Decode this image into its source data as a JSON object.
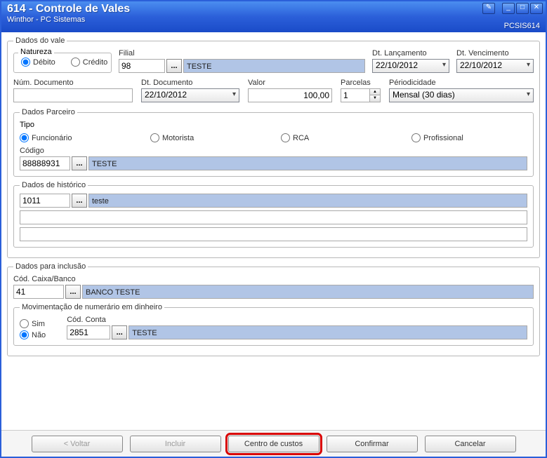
{
  "window": {
    "title": "614 - Controle de Vales",
    "subtitle": "Winthor - PC Sistemas",
    "code": "PCSIS614"
  },
  "dadosVale": {
    "legend": "Dados do vale",
    "natureza": {
      "legend": "Natureza",
      "debito": "Débito",
      "credito": "Crédito"
    },
    "filial": {
      "label": "Filial",
      "value": "98",
      "display": "TESTE"
    },
    "dtLanc": {
      "label": "Dt. Lançamento",
      "value": "22/10/2012"
    },
    "dtVenc": {
      "label": "Dt. Vencimento",
      "value": "22/10/2012"
    },
    "numDoc": {
      "label": "Núm. Documento",
      "value": ""
    },
    "dtDoc": {
      "label": "Dt. Documento",
      "value": "22/10/2012"
    },
    "valor": {
      "label": "Valor",
      "value": "100,00"
    },
    "parcelas": {
      "label": "Parcelas",
      "value": "1"
    },
    "periodo": {
      "label": "Périodicidade",
      "value": "Mensal     (30 dias)"
    }
  },
  "parceiro": {
    "legend": "Dados Parceiro",
    "tipoLegend": "Tipo",
    "tipos": {
      "func": "Funcionário",
      "mot": "Motorista",
      "rca": "RCA",
      "prof": "Profissional"
    },
    "codigo": {
      "label": "Código",
      "value": "88888931",
      "display": "TESTE"
    }
  },
  "historico": {
    "legend": "Dados de histórico",
    "value": "1011",
    "display": "teste"
  },
  "inclusao": {
    "legend": "Dados para inclusão",
    "caixa": {
      "label": "Cód. Caixa/Banco",
      "value": "41",
      "display": "BANCO TESTE"
    },
    "mov": {
      "legend": "Movimentação de numerário em dinheiro",
      "sim": "Sim",
      "nao": "Não",
      "conta": {
        "label": "Cód. Conta",
        "value": "2851",
        "display": "TESTE"
      }
    }
  },
  "buttons": {
    "voltar": "< Voltar",
    "incluir": "Incluir",
    "centro": "Centro de custos",
    "confirmar": "Confirmar",
    "cancelar": "Cancelar"
  },
  "browse": "..."
}
